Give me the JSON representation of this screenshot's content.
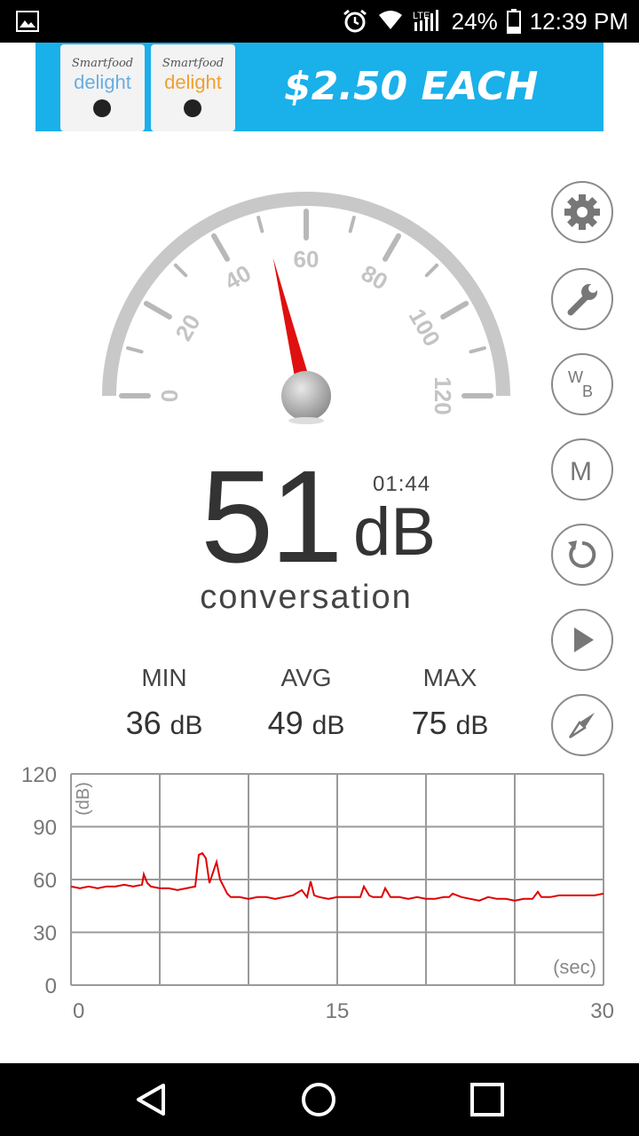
{
  "status_bar": {
    "battery": "24%",
    "time": "12:39 PM"
  },
  "ad": {
    "product_brand": "Smartfood",
    "product_name": "delight",
    "price_text": "$2.50 EACH"
  },
  "gauge": {
    "min": 0,
    "max": 120,
    "needle_value": 51,
    "labels": [
      "0",
      "20",
      "40",
      "60",
      "80",
      "100",
      "120"
    ]
  },
  "reading": {
    "value": "51",
    "unit": "dB",
    "elapsed": "01:44",
    "description": "conversation"
  },
  "stats": {
    "min": {
      "label": "MIN",
      "value": "36",
      "unit": "dB"
    },
    "avg": {
      "label": "AVG",
      "value": "49",
      "unit": "dB"
    },
    "max": {
      "label": "MAX",
      "value": "75",
      "unit": "dB"
    }
  },
  "side_buttons": [
    {
      "name": "settings-button",
      "icon": "gear-icon"
    },
    {
      "name": "tools-button",
      "icon": "wrench-icon"
    },
    {
      "name": "white-balance-button",
      "icon": "wb-icon"
    },
    {
      "name": "menu-m-button",
      "icon": "m-icon"
    },
    {
      "name": "reset-button",
      "icon": "refresh-icon"
    },
    {
      "name": "play-button",
      "icon": "play-icon"
    },
    {
      "name": "compass-button",
      "icon": "compass-icon"
    }
  ],
  "chart_data": {
    "type": "line",
    "ylabel": "(dB)",
    "xlabel": "(sec)",
    "ylim": [
      0,
      120
    ],
    "xlim": [
      0,
      30
    ],
    "yticks": [
      "0",
      "30",
      "60",
      "90",
      "120"
    ],
    "xticks": [
      "0",
      "15",
      "30"
    ],
    "grid": true,
    "series": [
      {
        "color": "#e00000",
        "x": [
          0,
          0.5,
          1,
          1.5,
          2,
          2.5,
          3,
          3.5,
          4,
          4.1,
          4.3,
          4.5,
          5,
          5.5,
          6,
          6.5,
          7,
          7.2,
          7.4,
          7.6,
          7.8,
          8,
          8.2,
          8.4,
          8.6,
          8.8,
          9,
          9.5,
          10,
          10.5,
          11,
          11.5,
          12,
          12.5,
          13,
          13.3,
          13.5,
          13.7,
          14,
          14.5,
          15,
          15.5,
          16,
          16.3,
          16.5,
          16.8,
          17,
          17.5,
          17.7,
          18,
          18.5,
          19,
          19.5,
          20,
          20.5,
          21,
          21.3,
          21.5,
          22,
          22.5,
          23,
          23.5,
          24,
          24.5,
          25,
          25.5,
          26,
          26.3,
          26.5,
          27,
          27.5,
          28,
          28.5,
          29,
          29.5,
          30
        ],
        "y": [
          56,
          55,
          56,
          55,
          56,
          56,
          57,
          56,
          57,
          63,
          58,
          56,
          55,
          55,
          54,
          55,
          56,
          74,
          75,
          72,
          58,
          64,
          70,
          60,
          56,
          52,
          50,
          50,
          49,
          50,
          50,
          49,
          50,
          51,
          54,
          50,
          59,
          51,
          50,
          49,
          50,
          50,
          50,
          50,
          56,
          51,
          50,
          50,
          55,
          50,
          50,
          49,
          50,
          49,
          49,
          50,
          50,
          52,
          50,
          49,
          48,
          50,
          49,
          49,
          48,
          49,
          49,
          53,
          50,
          50,
          51,
          51,
          51,
          51,
          51,
          52
        ]
      }
    ]
  },
  "nav_bar": {
    "back_icon": "back-triangle-icon",
    "home_icon": "home-circle-icon",
    "recents_icon": "recents-square-icon"
  }
}
